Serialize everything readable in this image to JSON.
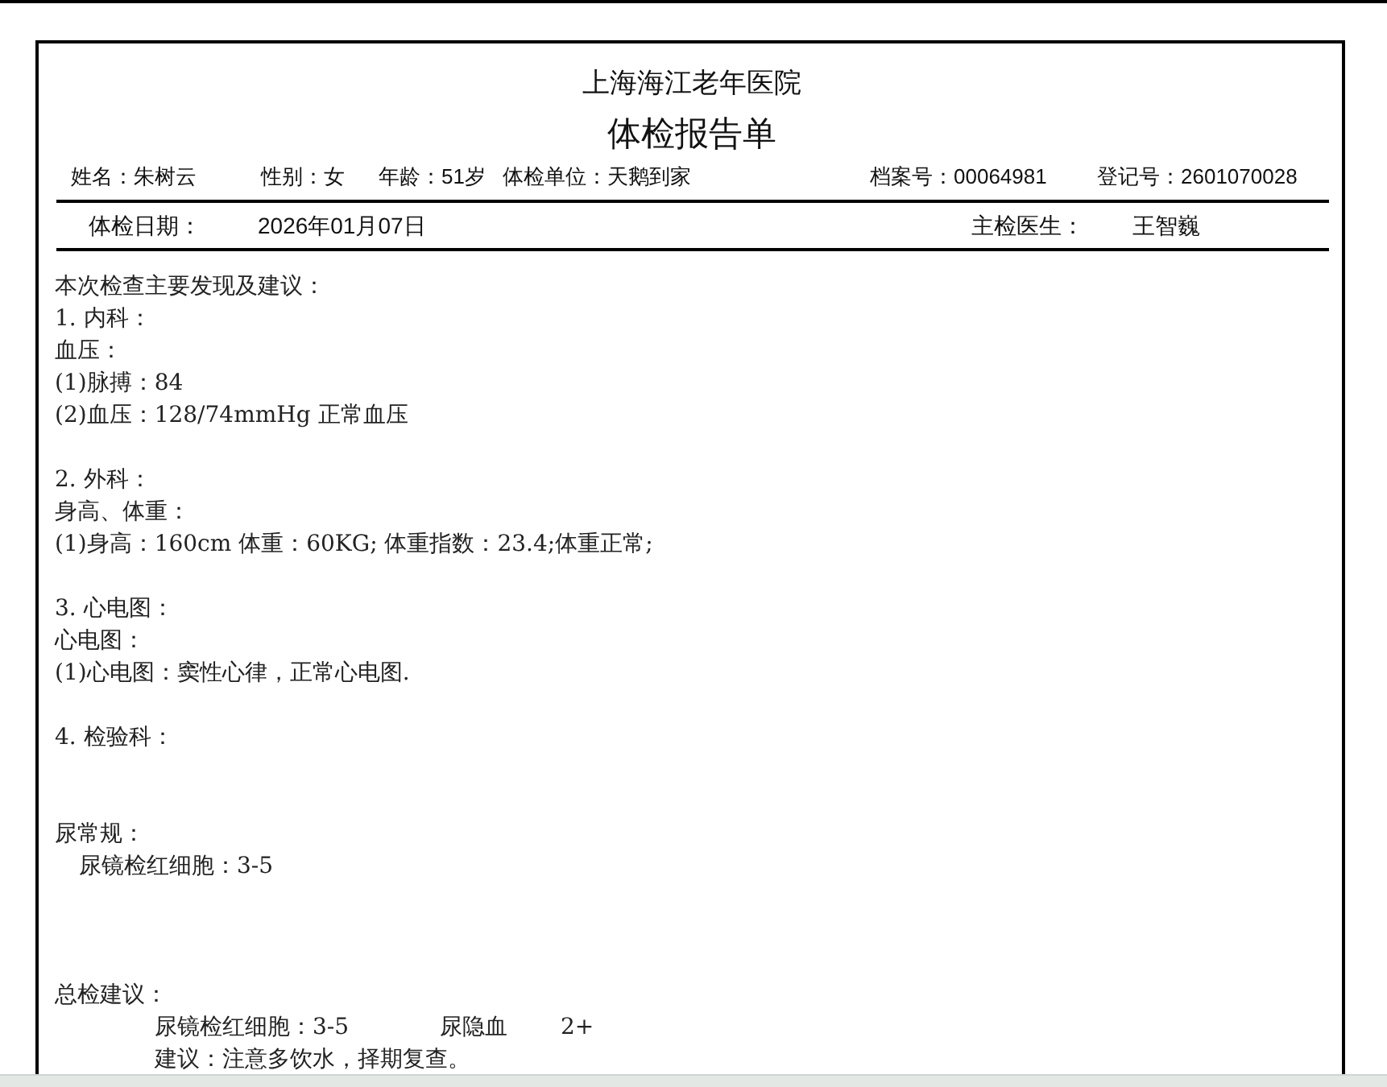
{
  "report": {
    "hospital": "上海海江老年医院",
    "title": "体检报告单",
    "patient_fields": [
      {
        "text": "姓名：朱树云"
      },
      {
        "text": "性别：女"
      },
      {
        "text": "年龄：51岁"
      },
      {
        "text": "体检单位：天鹅到家"
      },
      {
        "text": "档案号：00064981"
      },
      {
        "text": "登记号：2601070028"
      }
    ],
    "exam_date_label": "体检日期：",
    "exam_date": "2026年01月07日",
    "doctor_label": "主检医生：",
    "doctor": "王智巍",
    "lines": [
      {
        "kind": "text",
        "text": "本次检查主要发现及建议："
      },
      {
        "kind": "text",
        "text": "1.  内科："
      },
      {
        "kind": "text",
        "text": "血压："
      },
      {
        "kind": "text",
        "text": "(1)脉搏：84"
      },
      {
        "kind": "text",
        "text": "(2)血压：128/74mmHg 正常血压"
      },
      {
        "kind": "blank"
      },
      {
        "kind": "text",
        "text": "2.  外科："
      },
      {
        "kind": "text",
        "text": "身高、体重："
      },
      {
        "kind": "text",
        "text": "(1)身高：160cm 体重：60KG; 体重指数：23.4;体重正常;"
      },
      {
        "kind": "blank"
      },
      {
        "kind": "text",
        "text": "3.  心电图："
      },
      {
        "kind": "text",
        "text": "心电图："
      },
      {
        "kind": "text",
        "text": "(1)心电图：窦性心律，正常心电图."
      },
      {
        "kind": "blank"
      },
      {
        "kind": "text",
        "text": "4.  检验科："
      },
      {
        "kind": "blank"
      },
      {
        "kind": "blank"
      },
      {
        "kind": "text",
        "text": "尿常规："
      },
      {
        "kind": "sub",
        "text": "尿镜检红细胞：3-5"
      },
      {
        "kind": "blank"
      },
      {
        "kind": "blank"
      },
      {
        "kind": "blank"
      },
      {
        "kind": "text",
        "text": "总检建议："
      },
      {
        "kind": "columns",
        "cells": [
          "尿镜检红细胞：3-5",
          "尿隐血",
          "2+"
        ]
      },
      {
        "kind": "advice",
        "text": "建议：注意多饮水，择期复查。"
      }
    ]
  }
}
